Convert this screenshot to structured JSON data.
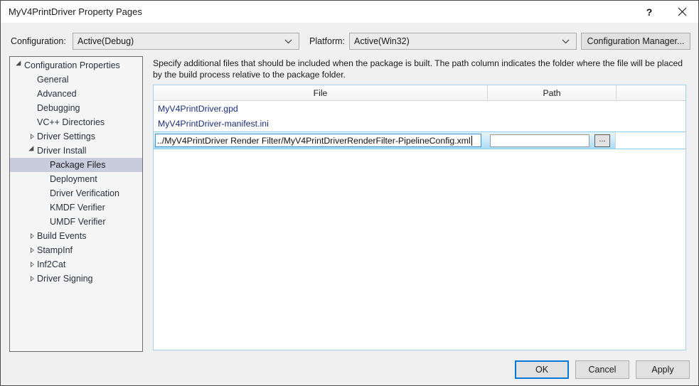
{
  "window": {
    "title": "MyV4PrintDriver Property Pages",
    "help_button": "?",
    "close_button": "✕"
  },
  "config_bar": {
    "configuration_label": "Configuration:",
    "configuration_value": "Active(Debug)",
    "platform_label": "Platform:",
    "platform_value": "Active(Win32)",
    "configuration_manager_label": "Configuration Manager..."
  },
  "tree": {
    "items": [
      {
        "label": "Configuration Properties",
        "level": 0,
        "state": "expanded",
        "selected": false
      },
      {
        "label": "General",
        "level": 1,
        "state": "leaf",
        "selected": false
      },
      {
        "label": "Advanced",
        "level": 1,
        "state": "leaf",
        "selected": false
      },
      {
        "label": "Debugging",
        "level": 1,
        "state": "leaf",
        "selected": false
      },
      {
        "label": "VC++ Directories",
        "level": 1,
        "state": "leaf",
        "selected": false
      },
      {
        "label": "Driver Settings",
        "level": 1,
        "state": "collapsed",
        "selected": false
      },
      {
        "label": "Driver Install",
        "level": 1,
        "state": "expanded",
        "selected": false
      },
      {
        "label": "Package Files",
        "level": 2,
        "state": "leaf",
        "selected": true
      },
      {
        "label": "Deployment",
        "level": 2,
        "state": "leaf",
        "selected": false
      },
      {
        "label": "Driver Verification",
        "level": 2,
        "state": "leaf",
        "selected": false
      },
      {
        "label": "KMDF Verifier",
        "level": 2,
        "state": "leaf",
        "selected": false
      },
      {
        "label": "UMDF Verifier",
        "level": 2,
        "state": "leaf",
        "selected": false
      },
      {
        "label": "Build Events",
        "level": 1,
        "state": "collapsed",
        "selected": false
      },
      {
        "label": "StampInf",
        "level": 1,
        "state": "collapsed",
        "selected": false
      },
      {
        "label": "Inf2Cat",
        "level": 1,
        "state": "collapsed",
        "selected": false
      },
      {
        "label": "Driver Signing",
        "level": 1,
        "state": "collapsed",
        "selected": false
      }
    ]
  },
  "content": {
    "description": "Specify additional files that should be included when the package is built.  The path column indicates the folder where the file will be placed by the build process relative to the package folder.",
    "grid": {
      "columns": [
        "File",
        "Path",
        ""
      ],
      "rows": [
        {
          "file": "MyV4PrintDriver.gpd",
          "path": ""
        },
        {
          "file": "MyV4PrintDriver-manifest.ini",
          "path": ""
        }
      ],
      "editing_row": {
        "file_value": "../MyV4PrintDriver Render Filter/MyV4PrintDriverRenderFilter-PipelineConfig.xml",
        "path_value": "",
        "browse_label": "..."
      }
    }
  },
  "footer": {
    "ok_label": "OK",
    "cancel_label": "Cancel",
    "apply_label": "Apply"
  },
  "colors": {
    "accent": "#0078d7",
    "link_text": "#1b2f7a",
    "selection": "#c8cddd",
    "grid_border": "#a8d0ea",
    "dialog_bg": "#f0f0f0"
  }
}
